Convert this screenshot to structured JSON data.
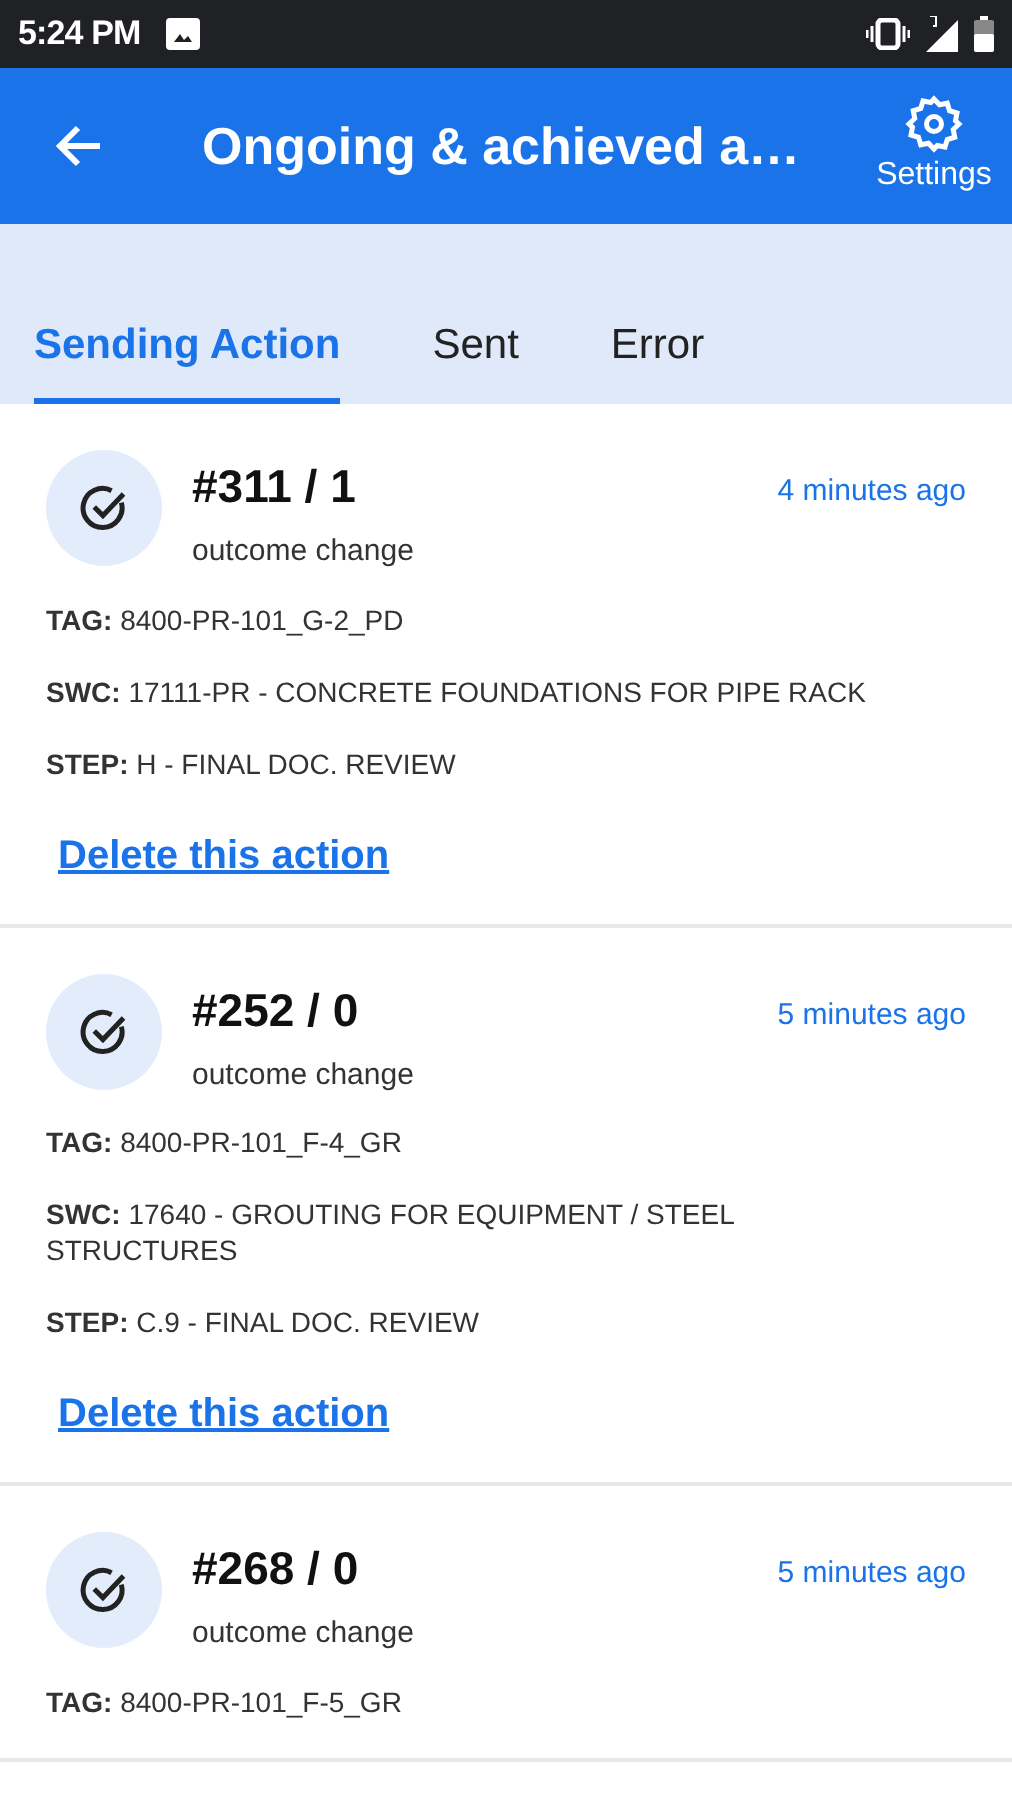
{
  "status_bar": {
    "time": "5:24 PM"
  },
  "app_bar": {
    "title": "Ongoing & achieved a…",
    "settings_label": "Settings"
  },
  "tabs": [
    {
      "label": "Sending Action",
      "selected": true
    },
    {
      "label": "Sent",
      "selected": false
    },
    {
      "label": "Error",
      "selected": false
    }
  ],
  "actions": [
    {
      "title": "#311 / 1",
      "subtitle": "outcome change",
      "time": "4 minutes ago",
      "details": [
        "**TAG:** 8400-PR-101_G-2_PD",
        "**SWC:** 17111-PR - CONCRETE FOUNDATIONS FOR PIPE RACK",
        "**STEP:** H - FINAL DOC. REVIEW"
      ],
      "link": "Delete this action"
    },
    {
      "title": "#252 / 0",
      "subtitle": "outcome change",
      "time": "5 minutes ago",
      "details": [
        "**TAG:** 8400-PR-101_F-4_GR",
        "**SWC:** 17640 - GROUTING FOR EQUIPMENT / STEEL STRUCTURES",
        "**STEP:** C.9 - FINAL DOC. REVIEW"
      ],
      "link": "Delete this action"
    },
    {
      "title": "#268 / 0",
      "subtitle": "outcome change",
      "time": "5 minutes ago",
      "details": [
        "**TAG:** 8400-PR-101_F-5_GR"
      ]
    }
  ]
}
